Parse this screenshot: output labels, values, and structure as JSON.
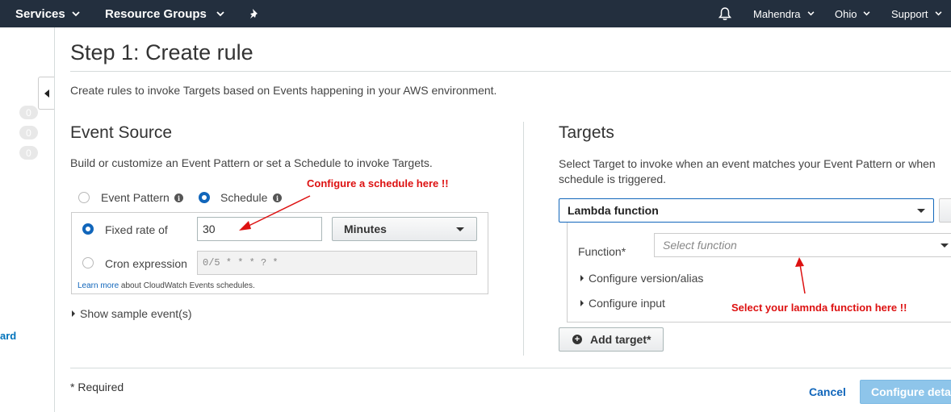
{
  "nav": {
    "services": "Services",
    "resource_groups": "Resource Groups",
    "user": "Mahendra",
    "region": "Ohio",
    "support": "Support"
  },
  "sidebar": {
    "counters": [
      "0",
      "0",
      "0"
    ],
    "link_fragment": "ard"
  },
  "page": {
    "title": "Step 1: Create rule",
    "subtitle": "Create rules to invoke Targets based on Events happening in your AWS environment."
  },
  "event_source": {
    "heading": "Event Source",
    "description": "Build or customize an Event Pattern or set a Schedule to invoke Targets.",
    "option_pattern": "Event Pattern",
    "option_schedule": "Schedule",
    "selected": "Schedule",
    "fixed_rate_label": "Fixed rate of",
    "fixed_rate_value": "30",
    "unit_value": "Minutes",
    "cron_label": "Cron expression",
    "cron_placeholder": "0/5 * * * ? *",
    "learn_more_link": "Learn more",
    "learn_more_rest": " about CloudWatch Events schedules.",
    "show_sample": "Show sample event(s)"
  },
  "targets": {
    "heading": "Targets",
    "description": "Select Target to invoke when an event matches your Event Pattern or when schedule is triggered.",
    "target_type": "Lambda function",
    "function_label": "Function*",
    "function_placeholder": "Select function",
    "configure_version": "Configure version/alias",
    "configure_input": "Configure input",
    "add_target": "Add target*"
  },
  "annotations": {
    "schedule_note": "Configure a schedule here !!",
    "function_note": "Select your lamnda function here !!"
  },
  "footer": {
    "required_note": "* Required",
    "cancel": "Cancel",
    "configure_details": "Configure details"
  },
  "colors": {
    "nav_bg": "#232f3e",
    "accent": "#1166bb",
    "annotation": "#dd1111",
    "primary_disabled": "#8ec5ea"
  }
}
